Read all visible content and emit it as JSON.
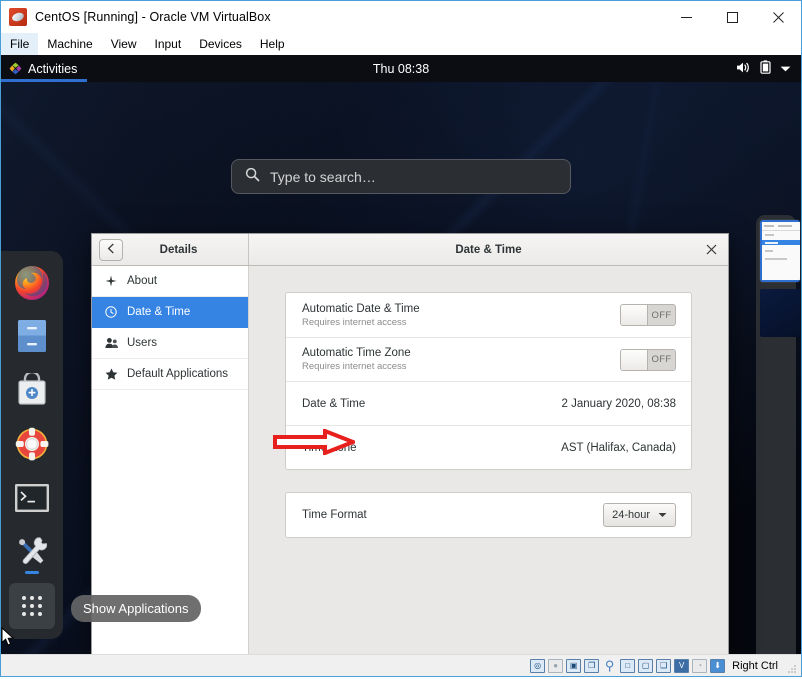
{
  "host_window": {
    "title": "CentOS [Running] - Oracle VM VirtualBox",
    "app_icon": "virtualbox-icon",
    "menus": [
      {
        "label": "File",
        "active": true
      },
      {
        "label": "Machine",
        "active": false
      },
      {
        "label": "View",
        "active": false
      },
      {
        "label": "Input",
        "active": false
      },
      {
        "label": "Devices",
        "active": false
      },
      {
        "label": "Help",
        "active": false
      }
    ],
    "window_buttons": [
      {
        "name": "minimize-button",
        "glyph": "minimize-icon"
      },
      {
        "name": "maximize-button",
        "glyph": "maximize-icon"
      },
      {
        "name": "close-button",
        "glyph": "close-icon"
      }
    ],
    "statusbar": {
      "indicators": [
        {
          "name": "hard-disk-indicator",
          "glyph": "◎"
        },
        {
          "name": "optical-disk-indicator",
          "glyph": "●"
        },
        {
          "name": "floppy-indicator",
          "glyph": "▣"
        },
        {
          "name": "network-indicator",
          "glyph": "❐"
        },
        {
          "name": "usb-indicator",
          "glyph": "⚲"
        },
        {
          "name": "shared-folders-indicator",
          "glyph": "□"
        },
        {
          "name": "display-indicator",
          "glyph": "▢"
        },
        {
          "name": "recording-indicator",
          "glyph": "❑"
        },
        {
          "name": "features-indicator",
          "glyph": "V"
        },
        {
          "name": "mouse-indicator",
          "glyph": "◔"
        },
        {
          "name": "host-key-indicator",
          "glyph": "⬇"
        }
      ],
      "host_key": "Right Ctrl"
    }
  },
  "gnome": {
    "topbar": {
      "activities_label": "Activities",
      "activities_icon": "centos-activities-icon",
      "clock": "Thu 08:38",
      "status_icons": [
        {
          "name": "volume-icon"
        },
        {
          "name": "battery-icon"
        },
        {
          "name": "chevron-down-icon"
        }
      ]
    },
    "search": {
      "placeholder": "Type to search…",
      "icon": "search-icon",
      "value": ""
    },
    "dock": {
      "items": [
        {
          "name": "dock-item-firefox",
          "label": "Firefox",
          "icon": "firefox-icon",
          "running": false
        },
        {
          "name": "dock-item-files",
          "label": "Files",
          "icon": "files-icon",
          "running": false
        },
        {
          "name": "dock-item-software",
          "label": "Software",
          "icon": "software-icon",
          "running": false
        },
        {
          "name": "dock-item-help",
          "label": "Help",
          "icon": "lifering-help-icon",
          "running": false
        },
        {
          "name": "dock-item-terminal",
          "label": "Terminal",
          "icon": "terminal-icon",
          "running": false
        },
        {
          "name": "dock-item-settings",
          "label": "Settings",
          "icon": "tools-settings-icon",
          "running": true
        }
      ],
      "show_applications": {
        "label": "Show Applications",
        "icon": "apps-grid-icon"
      }
    },
    "accent_color": "#3584e4",
    "topbar_color": "#0b0d12",
    "dock_color": "#262a2e"
  },
  "settings_window": {
    "back_button_icon": "chevron-left-icon",
    "sidebar_title": "Details",
    "title": "Date & Time",
    "close_icon": "close-icon",
    "sidebar": {
      "items": [
        {
          "label": "About",
          "icon": "about-star-icon",
          "selected": false
        },
        {
          "label": "Date & Time",
          "icon": "clock-icon",
          "selected": true
        },
        {
          "label": "Users",
          "icon": "users-icon",
          "selected": false
        },
        {
          "label": "Default Applications",
          "icon": "star-icon",
          "selected": false
        }
      ]
    },
    "cards": [
      {
        "rows": [
          {
            "kind": "toggle",
            "title": "Automatic Date & Time",
            "subtitle": "Requires internet access",
            "toggle_label": "OFF",
            "toggle_state": "off"
          },
          {
            "kind": "toggle",
            "title": "Automatic Time Zone",
            "subtitle": "Requires internet access",
            "toggle_label": "OFF",
            "toggle_state": "off"
          },
          {
            "kind": "value",
            "title": "Date & Time",
            "subtitle": "",
            "value": "2 January 2020, 08:38"
          },
          {
            "kind": "value",
            "title": "Time Zone",
            "subtitle": "",
            "value": "AST (Halifax, Canada)"
          }
        ]
      },
      {
        "rows": [
          {
            "kind": "combo",
            "title": "Time Format",
            "subtitle": "",
            "value": "24-hour",
            "combo_icon": "chevron-down-icon"
          }
        ]
      }
    ]
  },
  "annotation": {
    "arrow": {
      "name": "red-arrow-annotation",
      "color": "#e8201d",
      "points_to": "Time Zone"
    }
  }
}
